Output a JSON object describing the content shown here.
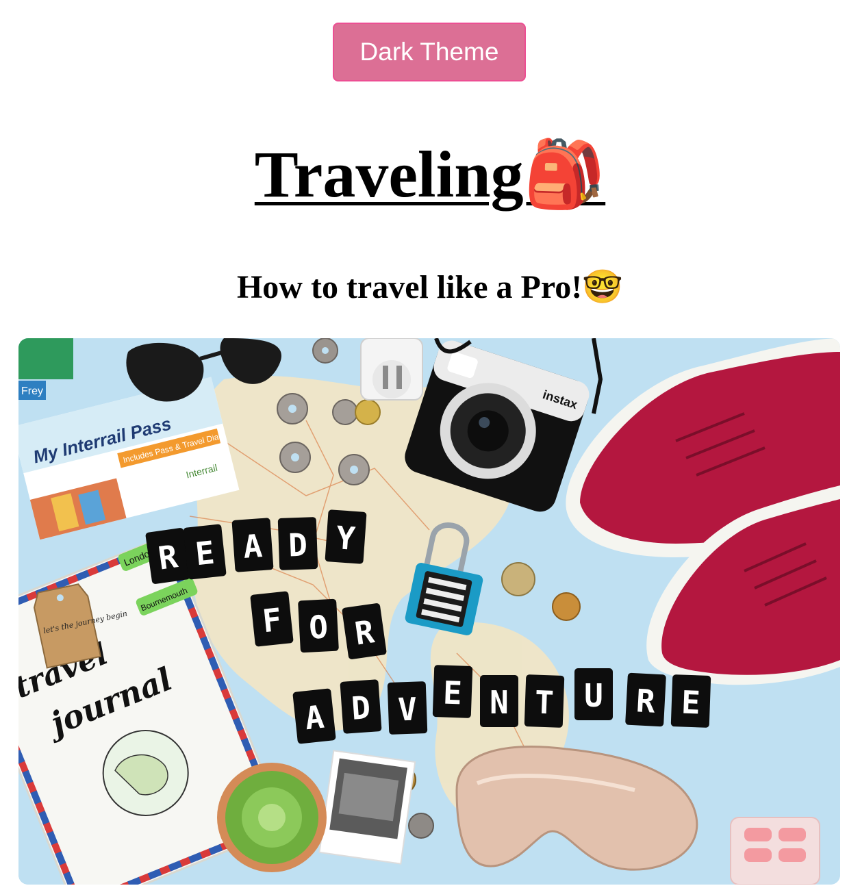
{
  "toolbar": {
    "theme_button_label": "Dark Theme",
    "accent_color": "#dc6f95"
  },
  "header": {
    "title": "Traveling🎒",
    "subtitle": "How to travel like a Pro!🤓"
  },
  "hero_image": {
    "letter_tiles": [
      "R",
      "E",
      "A",
      "D",
      "Y",
      "F",
      "O",
      "R",
      "A",
      "D",
      "V",
      "E",
      "N",
      "T",
      "U",
      "R",
      "E"
    ],
    "pass_text": "My Interrail Pass",
    "pass_sub": "Includes Pass & Travel Diary",
    "pass_brand": "Interrail",
    "frey_label": "Frey",
    "camera_brand": "instax",
    "journal_word_1": "travel",
    "journal_word_2": "journal",
    "tab_label_1": "London",
    "tab_label_2": "Bournemouth",
    "tag_text": "let's the journey begin"
  }
}
